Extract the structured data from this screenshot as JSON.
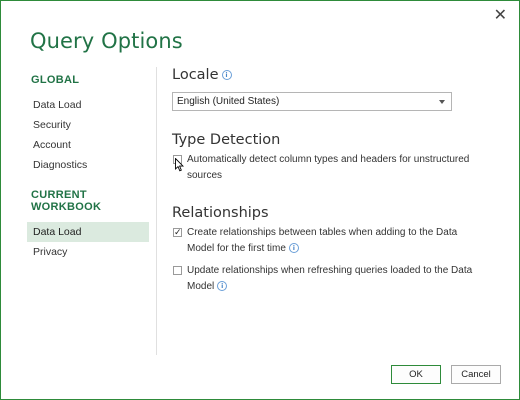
{
  "window": {
    "title": "Query Options",
    "close_glyph": "✕"
  },
  "sidebar": {
    "global_header": "GLOBAL",
    "global_items": [
      {
        "label": "Data Load"
      },
      {
        "label": "Security"
      },
      {
        "label": "Account"
      },
      {
        "label": "Diagnostics"
      }
    ],
    "workbook_header": "CURRENT WORKBOOK",
    "workbook_items": [
      {
        "label": "Data Load",
        "selected": true
      },
      {
        "label": "Privacy"
      }
    ]
  },
  "main": {
    "locale": {
      "heading": "Locale",
      "info_glyph": "i",
      "selected_value": "English (United States)"
    },
    "type_detection": {
      "heading": "Type Detection",
      "option_label": "Automatically detect column types and headers for unstructured sources",
      "checked": false
    },
    "relationships": {
      "heading": "Relationships",
      "option1_label": "Create relationships between tables when adding to the Data Model for the first time",
      "option1_checked": true,
      "option2_label": "Update relationships when refreshing queries loaded to the Data Model",
      "option2_checked": false
    }
  },
  "footer": {
    "ok_label": "OK",
    "cancel_label": "Cancel"
  },
  "colors": {
    "accent": "#217346",
    "border": "#2e8b3a",
    "selected_bg": "#dbeadf",
    "info_icon": "#4a86c8"
  }
}
